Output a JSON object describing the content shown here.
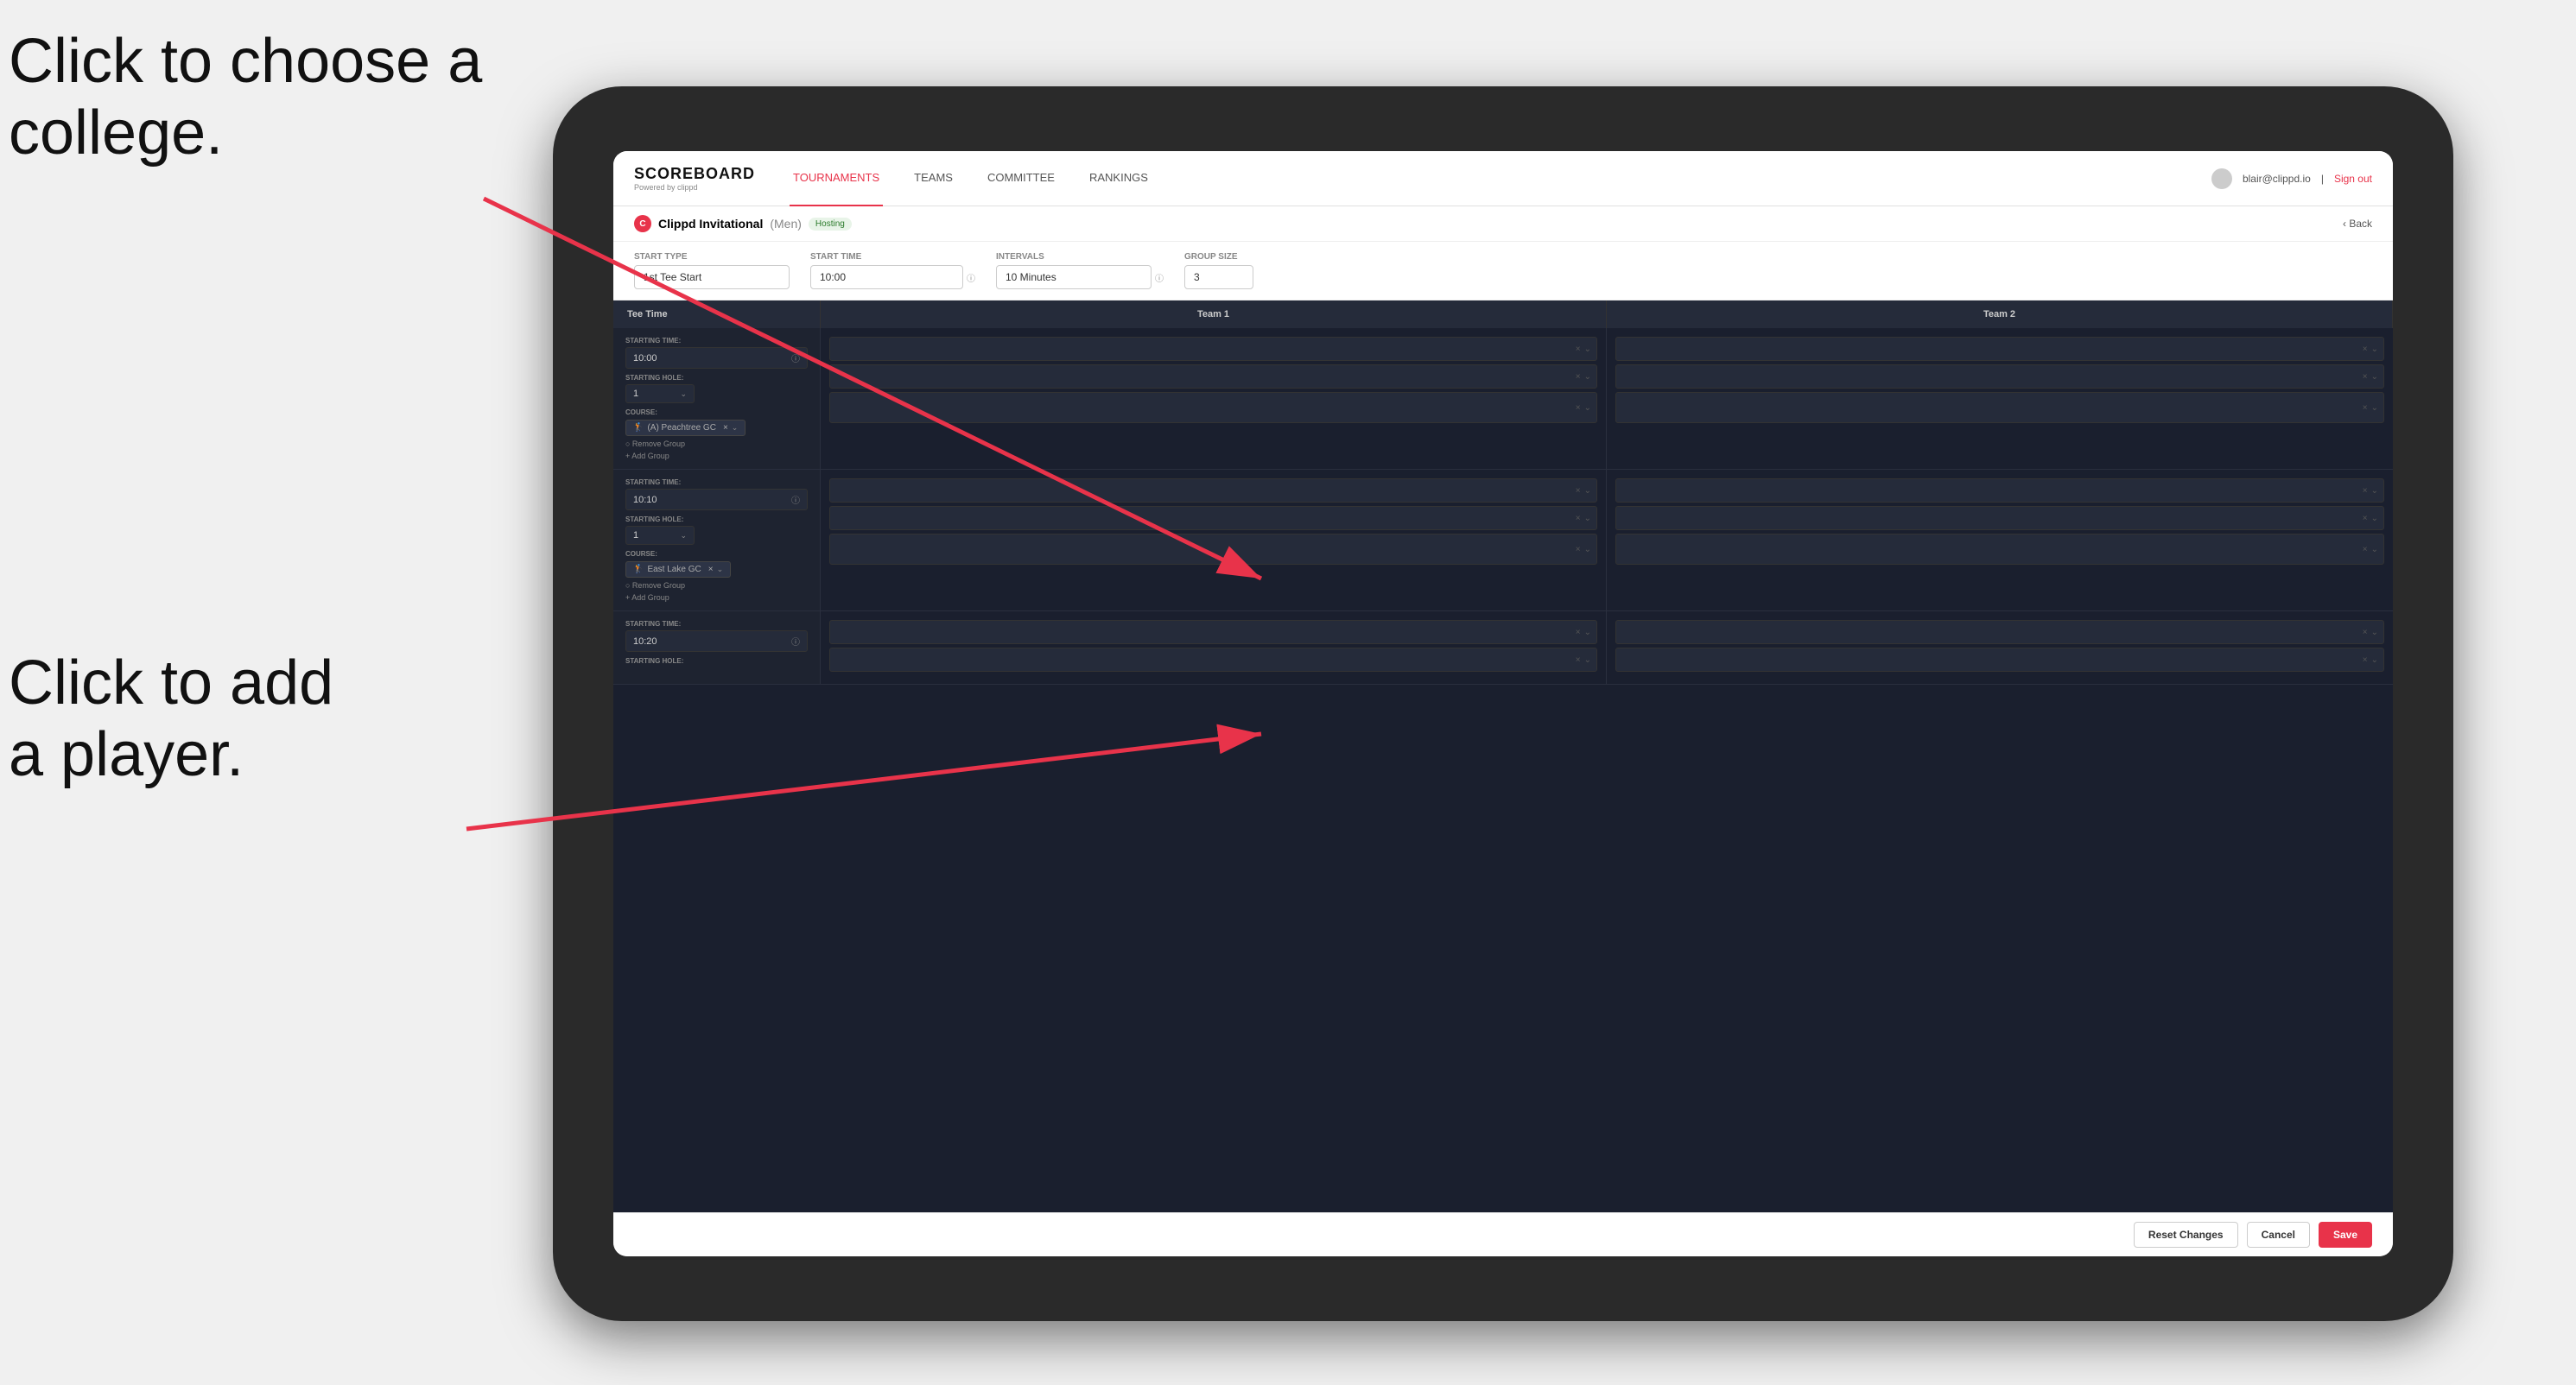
{
  "annotations": {
    "top": "Click to choose a\ncollege.",
    "bottom": "Click to add\na player."
  },
  "navbar": {
    "logo": "SCOREBOARD",
    "logo_sub": "Powered by clippd",
    "tabs": [
      "TOURNAMENTS",
      "TEAMS",
      "COMMITTEE",
      "RANKINGS"
    ],
    "active_tab": "TOURNAMENTS",
    "user_email": "blair@clippd.io",
    "sign_out": "Sign out"
  },
  "sub_header": {
    "tournament": "Clippd Invitational",
    "gender": "(Men)",
    "status": "Hosting",
    "back": "Back"
  },
  "form": {
    "start_type_label": "Start Type",
    "start_type_value": "1st Tee Start",
    "start_time_label": "Start Time",
    "start_time_value": "10:00",
    "intervals_label": "Intervals",
    "intervals_value": "10 Minutes",
    "group_size_label": "Group Size",
    "group_size_value": "3"
  },
  "table": {
    "col1": "Tee Time",
    "col2": "Team 1",
    "col3": "Team 2"
  },
  "groups": [
    {
      "starting_time": "10:00",
      "starting_hole": "1",
      "course": "(A) Peachtree GC",
      "team1_players": 2,
      "team2_players": 2,
      "actions": [
        "Remove Group",
        "Add Group"
      ]
    },
    {
      "starting_time": "10:10",
      "starting_hole": "1",
      "course": "East Lake GC",
      "team1_players": 2,
      "team2_players": 2,
      "actions": [
        "Remove Group",
        "Add Group"
      ]
    },
    {
      "starting_time": "10:20",
      "starting_hole": "",
      "course": "",
      "team1_players": 2,
      "team2_players": 2,
      "actions": []
    }
  ],
  "buttons": {
    "reset": "Reset Changes",
    "cancel": "Cancel",
    "save": "Save"
  }
}
